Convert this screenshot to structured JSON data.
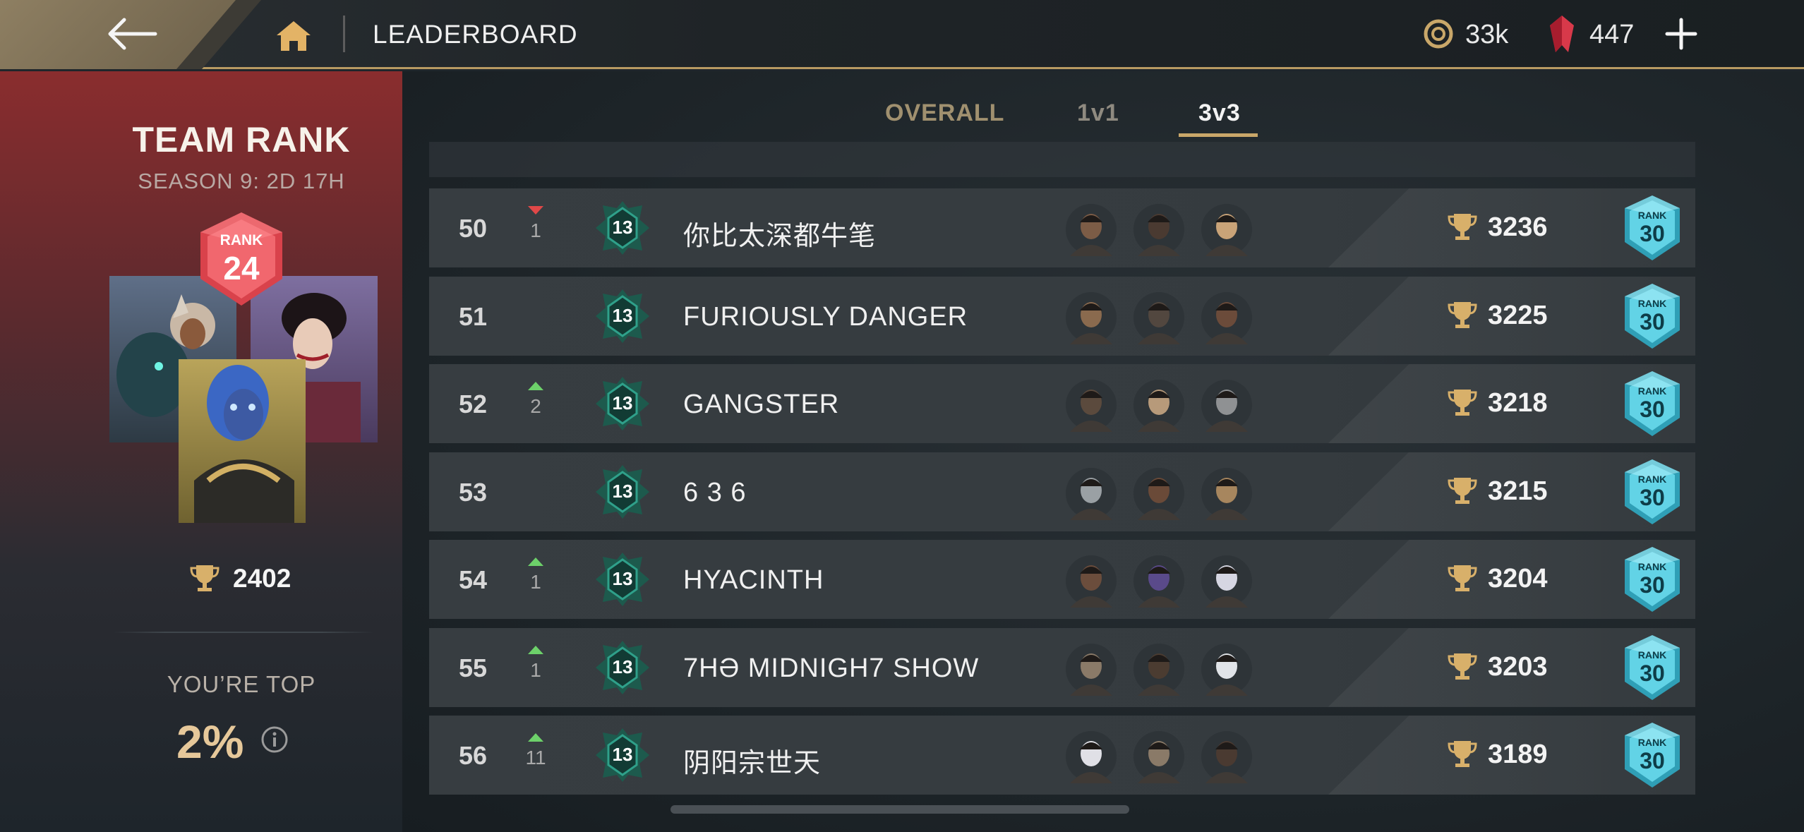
{
  "header": {
    "title": "LEADERBOARD",
    "coins": "33k",
    "gems": "447",
    "icons": [
      "back-arrow-icon",
      "home-icon",
      "coin-icon",
      "gem-icon",
      "plus-icon"
    ]
  },
  "team": {
    "title": "TEAM RANK",
    "season": "SEASON 9: 2D 17H",
    "rank_label": "RANK",
    "rank_number": "24",
    "score": "2402",
    "youre_top_label": "YOU’RE TOP",
    "top_percent": "2%"
  },
  "tabs": [
    {
      "label": "OVERALL",
      "active": false
    },
    {
      "label": "1v1",
      "active": false
    },
    {
      "label": "3v3",
      "active": true
    }
  ],
  "rows": [
    {
      "rank": "50",
      "change": "1",
      "direction": "down",
      "level": "13",
      "name": "你比太深都牛笔",
      "score": "3236",
      "rank_label": "RANK",
      "rank_tier": "30"
    },
    {
      "rank": "51",
      "change": "",
      "direction": "none",
      "level": "13",
      "name": "FURIOUSLY DANGER",
      "score": "3225",
      "rank_label": "RANK",
      "rank_tier": "30"
    },
    {
      "rank": "52",
      "change": "2",
      "direction": "up",
      "level": "13",
      "name": "GANGSTER",
      "score": "3218",
      "rank_label": "RANK",
      "rank_tier": "30"
    },
    {
      "rank": "53",
      "change": "",
      "direction": "none",
      "level": "13",
      "name": "6 3 6",
      "score": "3215",
      "rank_label": "RANK",
      "rank_tier": "30"
    },
    {
      "rank": "54",
      "change": "1",
      "direction": "up",
      "level": "13",
      "name": "HYACINTH",
      "score": "3204",
      "rank_label": "RANK",
      "rank_tier": "30"
    },
    {
      "rank": "55",
      "change": "1",
      "direction": "up",
      "level": "13",
      "name": "7HƏ MIDNIGH7 SHOW",
      "score": "3203",
      "rank_label": "RANK",
      "rank_tier": "30"
    },
    {
      "rank": "56",
      "change": "11",
      "direction": "up",
      "level": "13",
      "name": "阴阳宗世天",
      "score": "3189",
      "rank_label": "RANK",
      "rank_tier": "30"
    }
  ],
  "colors": {
    "gold": "#c9a769",
    "up_arrow": "#6dd16a",
    "down_arrow": "#e04848",
    "rank_badge": "#59c9de",
    "team_badge": "#e2555d"
  }
}
